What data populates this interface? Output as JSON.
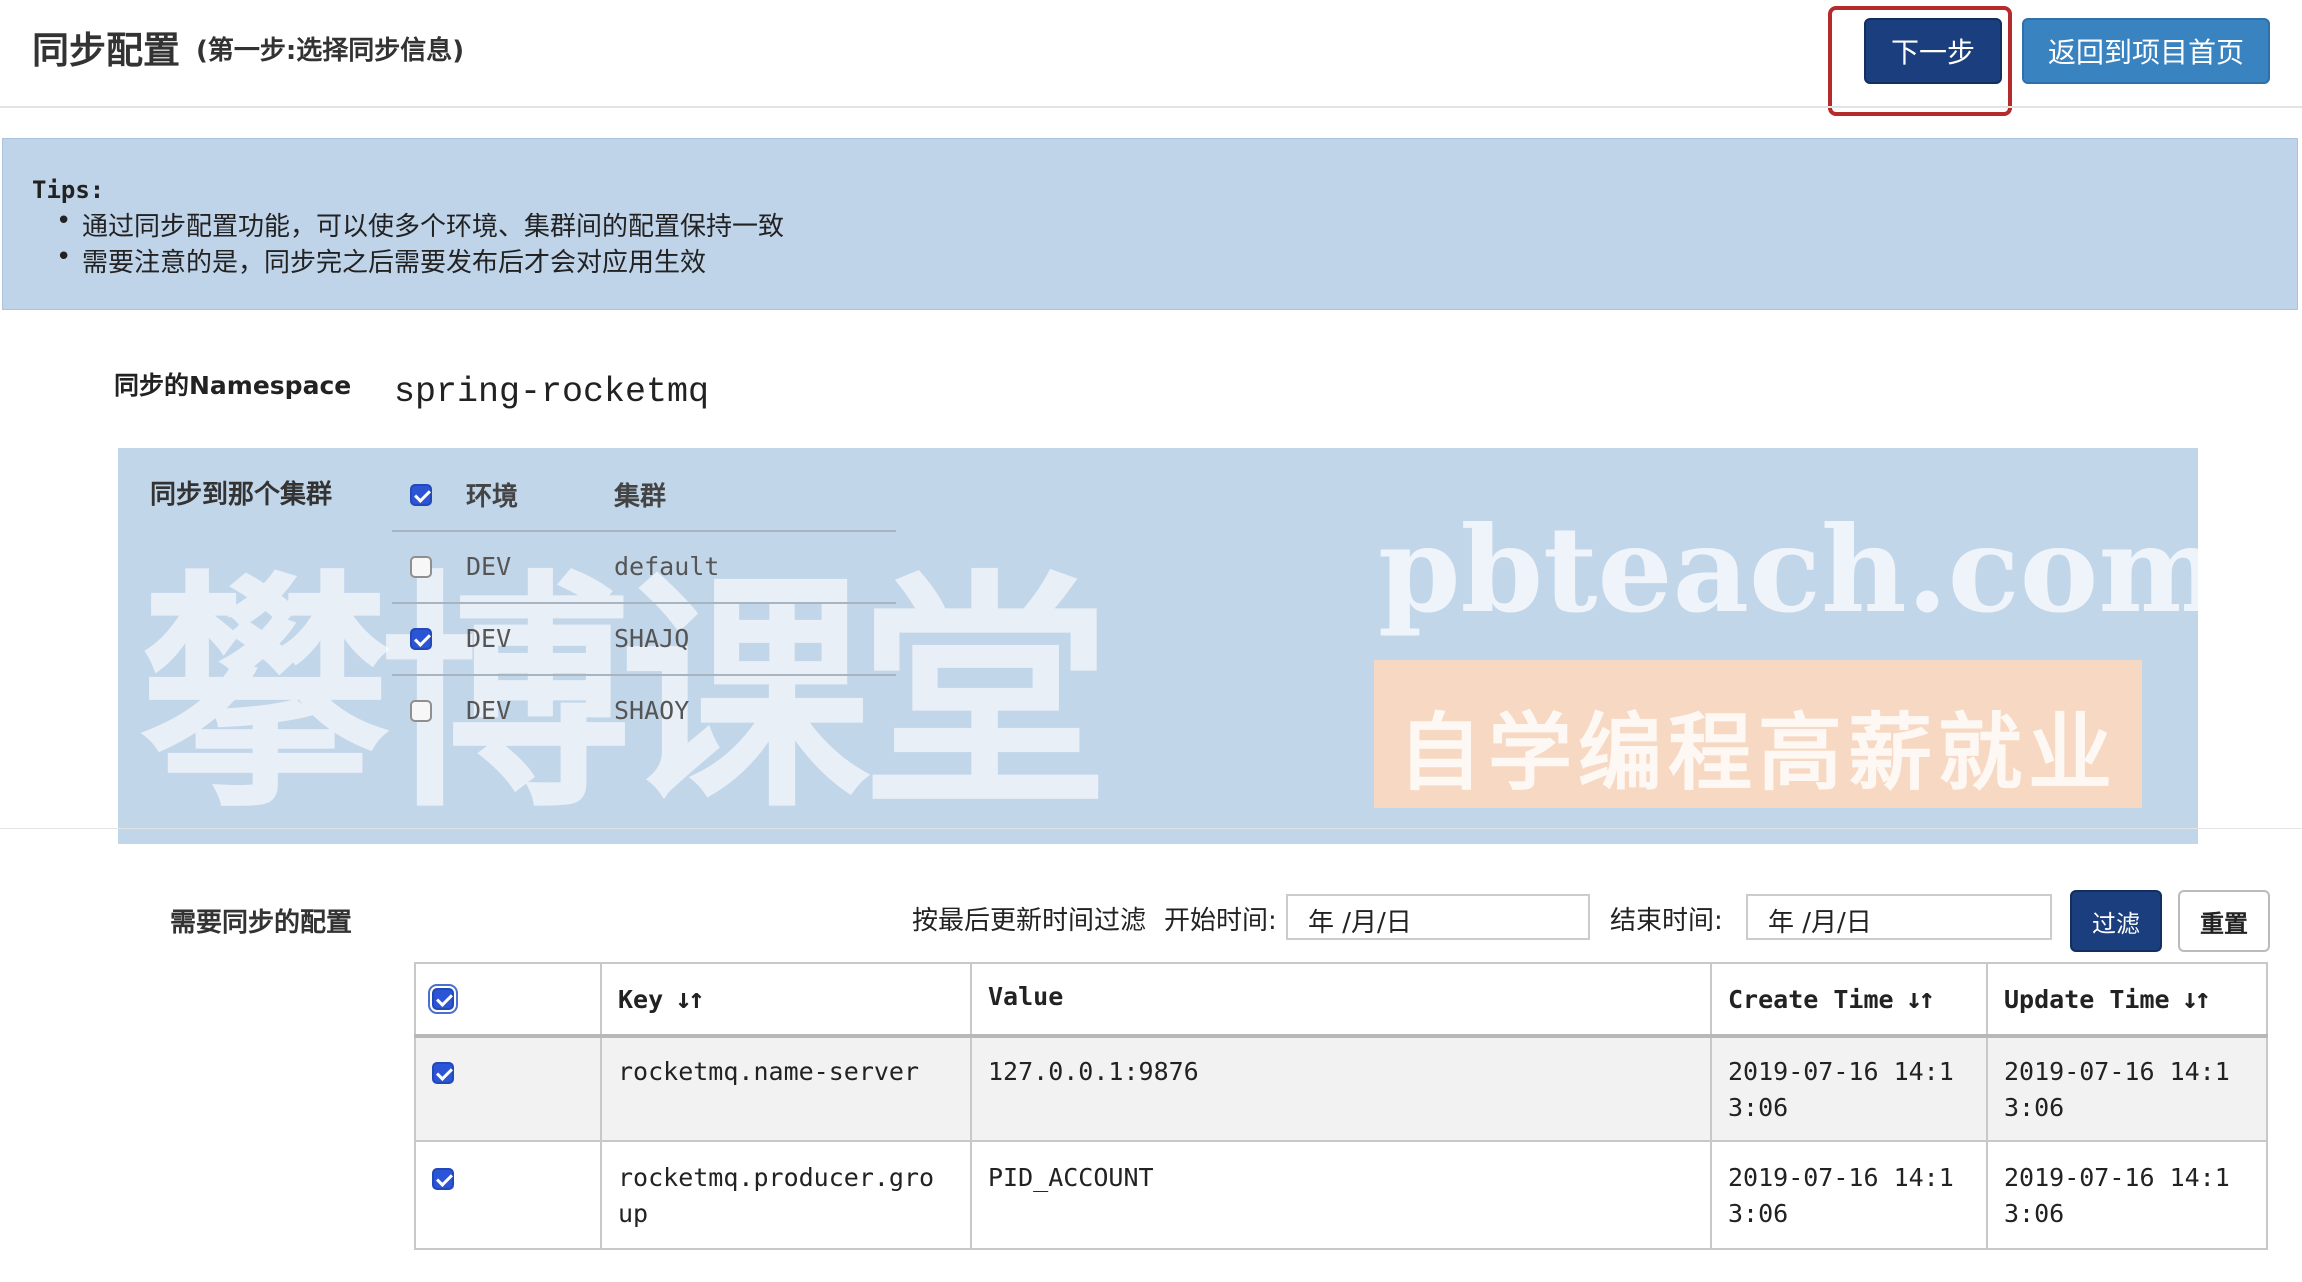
{
  "header": {
    "title": "同步配置",
    "subtitle": "(第一步:选择同步信息)",
    "next_button": "下一步",
    "back_button": "返回到项目首页"
  },
  "tips": {
    "title": "Tips:",
    "items": [
      "通过同步配置功能，可以使多个环境、集群间的配置保持一致",
      "需要注意的是，同步完之后需要发布后才会对应用生效"
    ]
  },
  "namespace": {
    "label": "同步的Namespace",
    "value": "spring-rocketmq"
  },
  "clusters": {
    "label": "同步到那个集群",
    "header_checked": true,
    "columns": [
      "环境",
      "集群"
    ],
    "rows": [
      {
        "env": "DEV",
        "cluster": "default",
        "checked": false
      },
      {
        "env": "DEV",
        "cluster": "SHAJQ",
        "checked": true
      },
      {
        "env": "DEV",
        "cluster": "SHAOY",
        "checked": false
      }
    ]
  },
  "watermark": {
    "brand": "攀博课堂",
    "url": "pbteach.com",
    "slogan": "自学编程高薪就业"
  },
  "configs": {
    "label": "需要同步的配置",
    "filter_label": "按最后更新时间过滤",
    "start_label": "开始时间:",
    "end_label": "结束时间:",
    "start_placeholder": "年  /月/日",
    "end_placeholder": "年  /月/日",
    "filter_button": "过滤",
    "reset_button": "重置",
    "columns": {
      "key": "Key",
      "value": "Value",
      "create_time": "Create Time",
      "update_time": "Update Time"
    },
    "sort_icon": "sort-icon",
    "rows": [
      {
        "checked": true,
        "key_line1": "rocketmq.name-server",
        "key_line2": "",
        "value": "127.0.0.1:9876",
        "create_line1": "2019-07-16 14:1",
        "create_line2": "3:06",
        "update_line1": "2019-07-16 14:1",
        "update_line2": "3:06"
      },
      {
        "checked": true,
        "key_line1": "rocketmq.producer.gro",
        "key_line2": "up",
        "value": "PID_ACCOUNT",
        "create_line1": "2019-07-16 14:1",
        "create_line2": "3:06",
        "update_line1": "2019-07-16 14:1",
        "update_line2": "3:06"
      }
    ]
  },
  "colors": {
    "primary_button": "#1a3e7e",
    "secondary_button": "#3a83c1",
    "tips_background": "#bfd3e9",
    "highlight_border": "#b52a2a",
    "checkbox_checked": "#2b55d6"
  }
}
